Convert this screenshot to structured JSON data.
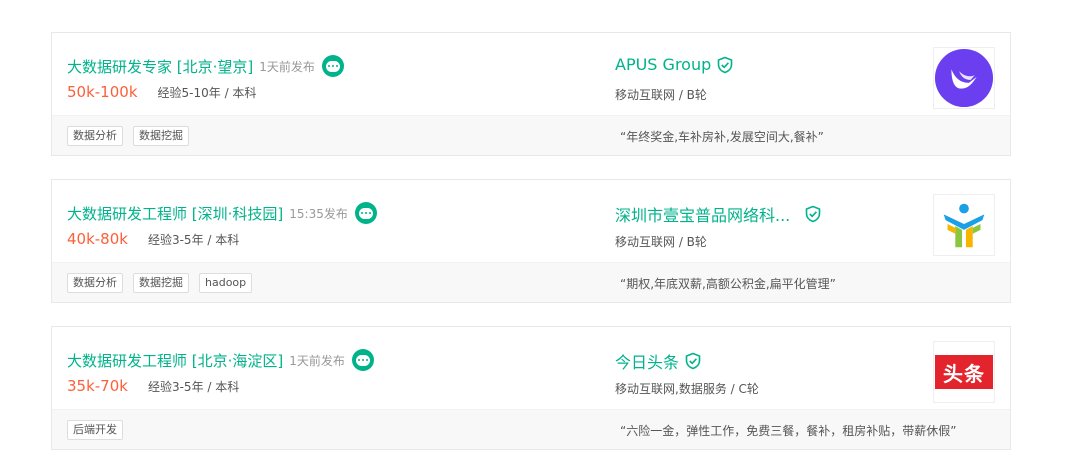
{
  "jobs": [
    {
      "title": "大数据研发专家 [北京·望京]",
      "published": "1天前发布",
      "salary": "50k-100k",
      "requirements": "经验5-10年 / 本科",
      "company": "APUS Group",
      "industry": "移动互联网 / B轮",
      "tags": [
        "数据分析",
        "数据挖掘"
      ],
      "benefits": "“年终奖金,车补房补,发展空间大,餐补”",
      "logo_icon": "apus-swallow-logo-icon"
    },
    {
      "title": "大数据研发工程师 [深圳·科技园]",
      "published": "15:35发布",
      "salary": "40k-80k",
      "requirements": "经验3-5年 / 本科",
      "company": "深圳市壹宝普品网络科...",
      "industry": "移动互联网 / B轮",
      "tags": [
        "数据分析",
        "数据挖掘",
        "hadoop"
      ],
      "benefits": "“期权,年底双薪,高额公积金,扁平化管理”",
      "logo_icon": "people-logo-icon"
    },
    {
      "title": "大数据研发工程师 [北京·海淀区]",
      "published": "1天前发布",
      "salary": "35k-70k",
      "requirements": "经验3-5年 / 本科",
      "company": "今日头条",
      "industry": "移动互联网,数据服务 / C轮",
      "tags": [
        "后端开发"
      ],
      "benefits": "“六险一金，弹性工作，免费三餐，餐补，租房补贴，带薪休假”",
      "logo_icon": "toutiao-logo-icon",
      "logo_text": "头条"
    }
  ],
  "colors": {
    "accent": "#00b38a",
    "salary": "#fd5f39",
    "apus_purple": "#6b3ff0",
    "toutiao_red": "#e4242c"
  }
}
